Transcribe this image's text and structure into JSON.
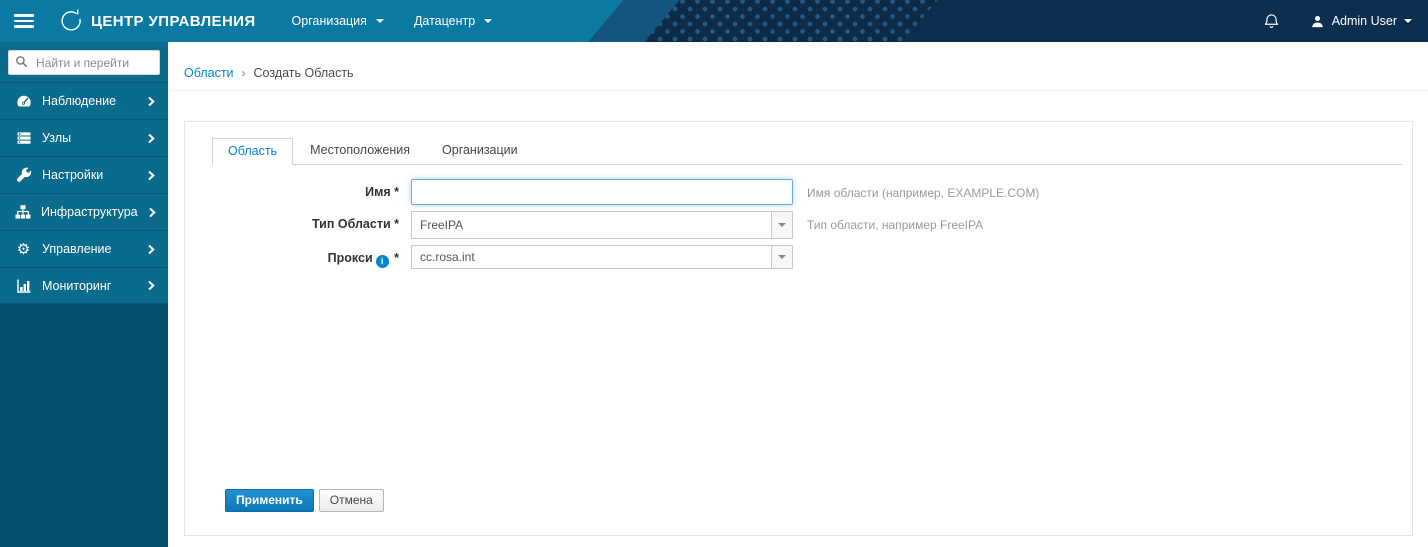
{
  "topbar": {
    "brand": "ЦЕНТР УПРАВЛЕНИЯ",
    "menus": [
      {
        "label": "Организация"
      },
      {
        "label": "Датацентр"
      }
    ],
    "user": {
      "name": "Admin User"
    }
  },
  "sidebar": {
    "search_placeholder": "Найти и перейти",
    "items": [
      {
        "label": "Наблюдение",
        "icon": "tachometer-icon"
      },
      {
        "label": "Узлы",
        "icon": "hosts-icon"
      },
      {
        "label": "Настройки",
        "icon": "wrench-icon"
      },
      {
        "label": "Инфраструктура",
        "icon": "sitemap-icon"
      },
      {
        "label": "Управление",
        "icon": "gear-icon"
      },
      {
        "label": "Мониторинг",
        "icon": "bar-chart-icon"
      }
    ]
  },
  "breadcrumb": {
    "link": "Области",
    "separator": "›",
    "current": "Создать Область"
  },
  "tabs": [
    {
      "label": "Область",
      "active": true
    },
    {
      "label": "Местоположения",
      "active": false
    },
    {
      "label": "Организации",
      "active": false
    }
  ],
  "form": {
    "fields": [
      {
        "label": "Имя",
        "star": "*",
        "value": "",
        "hint": "Имя области (например, EXAMPLE.COM)"
      },
      {
        "label": "Тип Области",
        "star": "*",
        "value": "FreeIPA",
        "hint": "Тип области, например FreeIPA"
      },
      {
        "label": "Прокси",
        "star": "*",
        "value": "cc.rosa.int",
        "hint": ""
      }
    ],
    "submit_label": "Применить",
    "cancel_label": "Отмена"
  },
  "icons": {
    "info_glyph": "i"
  },
  "colors": {
    "topbar_teal": "#0b7aa2",
    "topbar_navy": "#0d2f4f",
    "sidebar_teal": "#0a6b8d",
    "sidebar_dark": "#04516d",
    "accent_blue": "#0088ce",
    "primary_button": "#0f77b7",
    "focus_border": "#66afe9"
  }
}
